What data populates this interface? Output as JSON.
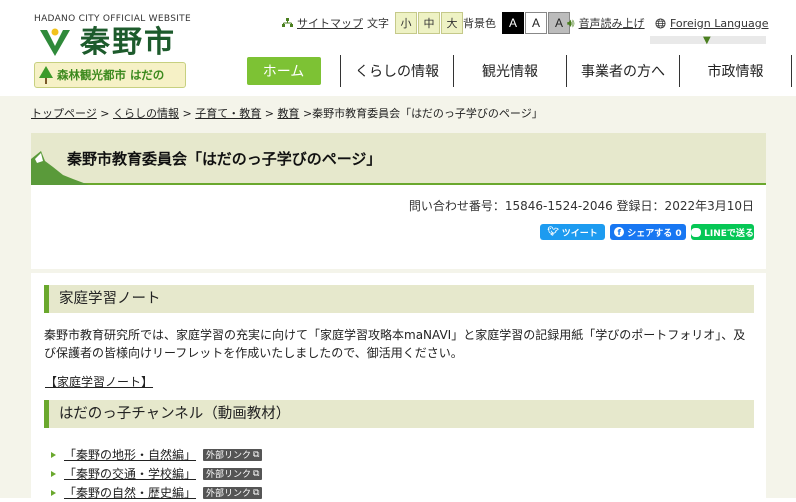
{
  "header": {
    "site_en": "HADANO CITY OFFICIAL WEBSITE",
    "logo_text": "秦野市",
    "banner_text": "森林観光都市 はだの"
  },
  "utility": {
    "sitemap": "サイトマップ",
    "font_size_label": "文字",
    "font_sizes": [
      "小",
      "中",
      "大"
    ],
    "bg_color_label": "背景色",
    "bg_buttons": [
      "A",
      "A",
      "A"
    ],
    "speech": "音声読み上げ",
    "foreign": "Foreign Language"
  },
  "nav": [
    "ホーム",
    "くらしの情報",
    "観光情報",
    "事業者の方へ",
    "市政情報"
  ],
  "breadcrumb": [
    "トップページ",
    "くらしの情報",
    "子育て・教育",
    "教育",
    "秦野市教育委員会「はだのっ子学びのページ」"
  ],
  "breadcrumb_sep": ">",
  "page": {
    "title": "秦野市教育委員会「はだのっ子学びのページ」",
    "meta": "問い合わせ番号：15846-1524-2046 登録日：2022年3月10日"
  },
  "share": {
    "tweet": "ツイート",
    "facebook": "シェアする 0",
    "line": "LINEで送る"
  },
  "sections": [
    {
      "heading": "家庭学習ノート",
      "body": "秦野市教育研究所では、家庭学習の充実に向けて「家庭学習攻略本maNAVI」と家庭学習の記録用紙「学びのポートフォリオ」、及び保護者の皆様向けリーフレットを作成いたしましたので、御活用ください。",
      "link": "【家庭学習ノート】"
    },
    {
      "heading": "はだのっ子チャンネル（動画教材）",
      "items": [
        "「秦野の地形・自然編」",
        "「秦野の交通・学校編」",
        "「秦野の自然・歴史編」"
      ],
      "ext_label": "外部リンク"
    }
  ],
  "colors": {
    "accent": "#6aa82d",
    "nav_active": "#7dc234",
    "title_bg": "#e6e8cc",
    "logo": "#1d5b2c"
  }
}
